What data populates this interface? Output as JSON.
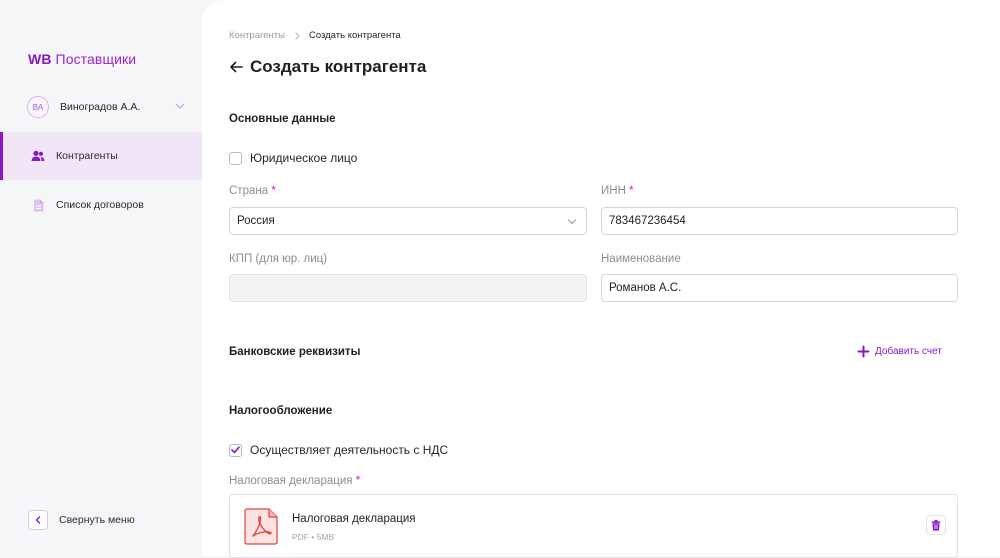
{
  "sidebar": {
    "logo_wb": "WB",
    "logo_name": "Поставщики",
    "user": {
      "initials": "ВА",
      "name": "Виноградов А.А."
    },
    "items": [
      {
        "label": "Контрагенты",
        "icon": "users-icon",
        "active": true
      },
      {
        "label": "Список договоров",
        "icon": "document-icon",
        "active": false
      }
    ],
    "collapse_label": "Свернуть меню"
  },
  "breadcrumb": {
    "parent": "Контрагенты",
    "current": "Создать контрагента"
  },
  "page_title": "Создать контрагента",
  "basic": {
    "section_title": "Основные данные",
    "legal_entity_label": "Юридическое лицо",
    "legal_entity_checked": false,
    "country": {
      "label": "Страна",
      "required_mark": "*",
      "value": "Россия"
    },
    "inn": {
      "label": "ИНН",
      "required_mark": "*",
      "value": "783467236454"
    },
    "kpp": {
      "label": "КПП (для юр. лиц)",
      "value": ""
    },
    "name": {
      "label": "Наименование",
      "value": "Романов А.С."
    }
  },
  "bank": {
    "section_title": "Банковские реквизиты",
    "add_label": "Добавить счет"
  },
  "tax": {
    "section_title": "Налогообложение",
    "vat_label": "Осуществляет деятельность с НДС",
    "vat_checked": true,
    "declaration_label": "Налоговая декларация",
    "required_mark": "*",
    "file": {
      "name": "Налоговая декларация",
      "meta": "PDF • 5MB"
    }
  },
  "colors": {
    "accent": "#8a16c9",
    "required": "#cc1bd0",
    "pdf": "#e2443f"
  }
}
